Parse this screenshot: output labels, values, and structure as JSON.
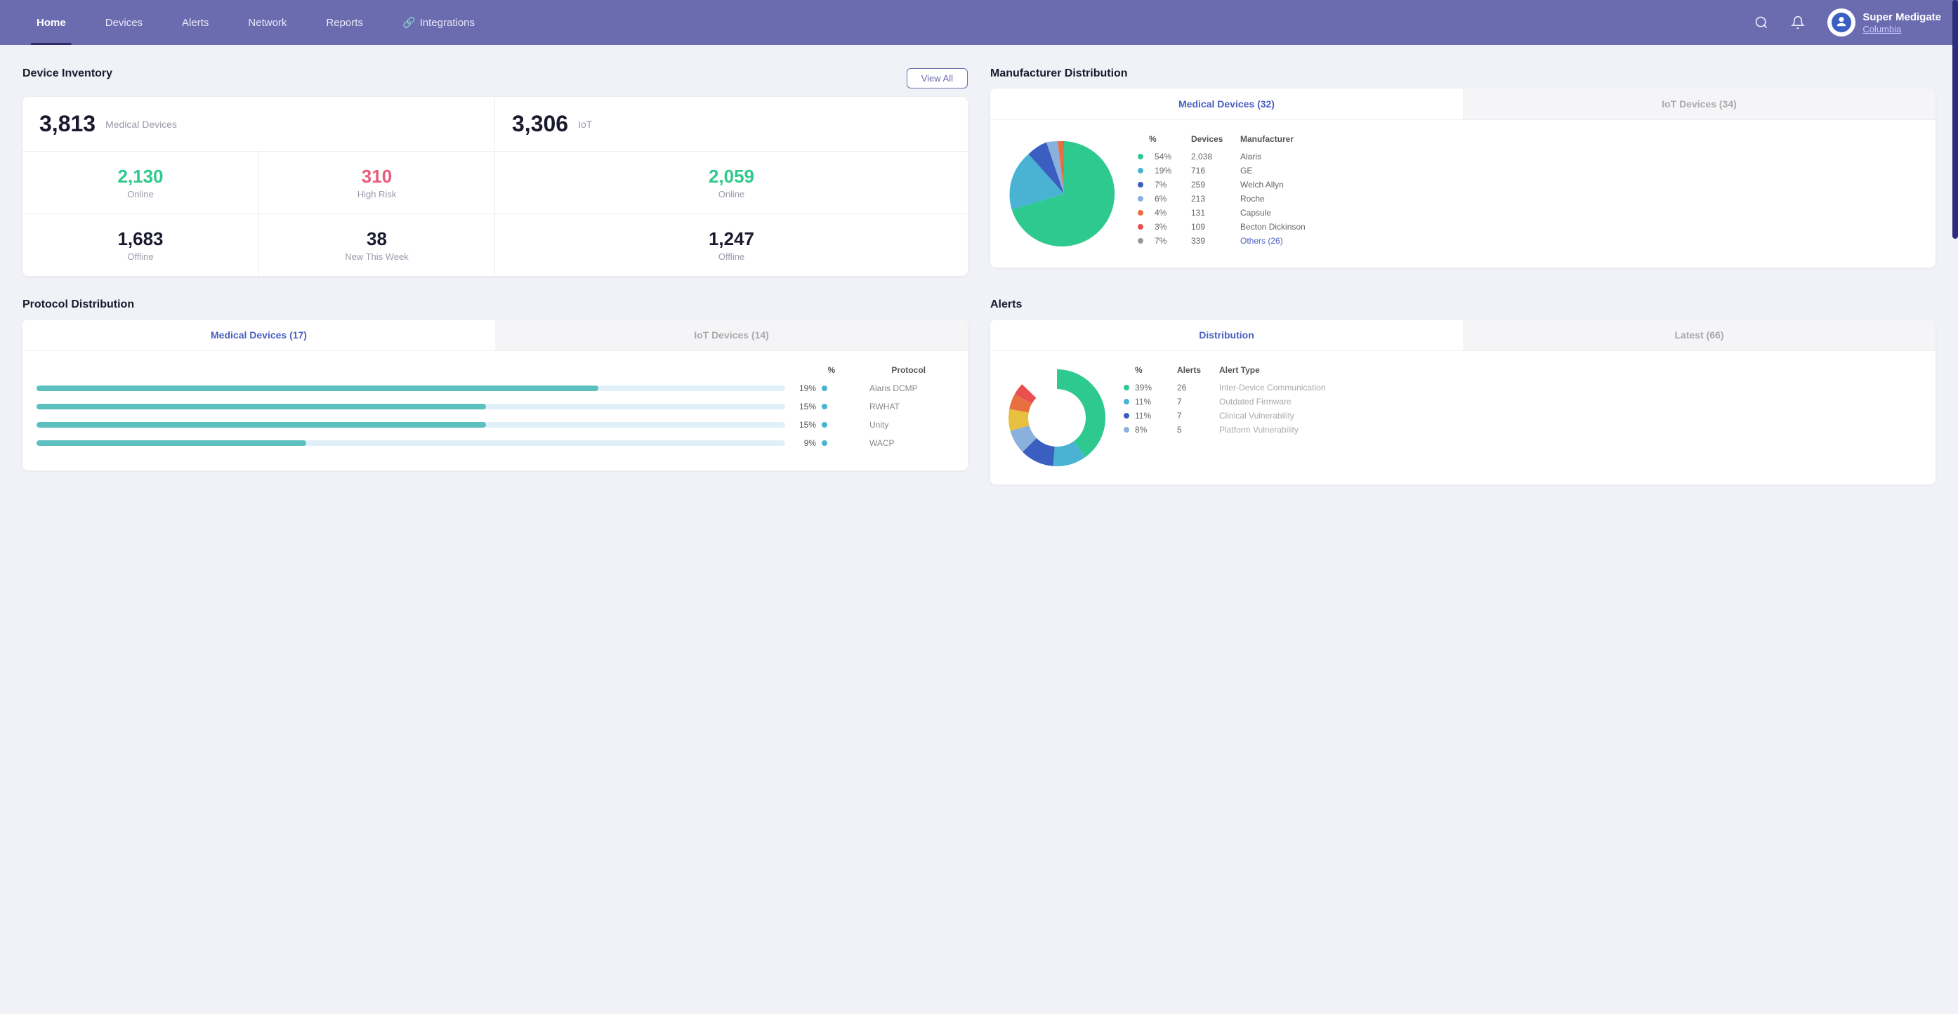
{
  "nav": {
    "items": [
      {
        "label": "Home",
        "active": true
      },
      {
        "label": "Devices",
        "active": false
      },
      {
        "label": "Alerts",
        "active": false
      },
      {
        "label": "Network",
        "active": false
      },
      {
        "label": "Reports",
        "active": false
      },
      {
        "label": "Integrations",
        "active": false
      }
    ],
    "user_name": "Super Medigate",
    "user_org": "Columbia"
  },
  "device_inventory": {
    "title": "Device Inventory",
    "view_all": "View All",
    "medical_count": "3,813",
    "medical_label": "Medical Devices",
    "iot_count": "3,306",
    "iot_label": "IoT",
    "online_count": "2,130",
    "online_label": "Online",
    "high_risk_count": "310",
    "high_risk_label": "High Risk",
    "iot_online_count": "2,059",
    "iot_online_label": "Online",
    "offline_count": "1,683",
    "offline_label": "Offline",
    "new_week_count": "38",
    "new_week_label": "New This Week",
    "iot_offline_count": "1,247",
    "iot_offline_label": "Offline"
  },
  "manufacturer": {
    "title": "Manufacturer Distribution",
    "tab_medical": "Medical Devices (32)",
    "tab_iot": "IoT Devices (34)",
    "col_pct": "%",
    "col_devices": "Devices",
    "col_manufacturer": "Manufacturer",
    "rows": [
      {
        "color": "#2ec98e",
        "pct": "54%",
        "devices": "2,038",
        "name": "Alaris"
      },
      {
        "color": "#4ab3d4",
        "pct": "19%",
        "devices": "716",
        "name": "GE"
      },
      {
        "color": "#3a5fc1",
        "pct": "7%",
        "devices": "259",
        "name": "Welch Allyn"
      },
      {
        "color": "#8ab0dc",
        "pct": "6%",
        "devices": "213",
        "name": "Roche"
      },
      {
        "color": "#e87040",
        "pct": "4%",
        "devices": "131",
        "name": "Capsule"
      },
      {
        "color": "#e85050",
        "pct": "3%",
        "devices": "109",
        "name": "Becton Dickinson"
      },
      {
        "color": "#999",
        "pct": "7%",
        "devices": "339",
        "name": "Others (26)",
        "link": true
      }
    ]
  },
  "protocol": {
    "title": "Protocol Distribution",
    "tab_medical": "Medical Devices (17)",
    "tab_iot": "IoT Devices (14)",
    "col_pct": "%",
    "col_protocol": "Protocol",
    "rows": [
      {
        "color": "#4ab3d4",
        "pct": "19%",
        "name": "Alaris DCMP",
        "bar": 75
      },
      {
        "color": "#4ab3d4",
        "pct": "15%",
        "name": "RWHAT",
        "bar": 60
      },
      {
        "color": "#4ab3d4",
        "pct": "15%",
        "name": "Unity",
        "bar": 60
      },
      {
        "color": "#4ab3d4",
        "pct": "9%",
        "name": "WACP",
        "bar": 36
      }
    ]
  },
  "alerts": {
    "title": "Alerts",
    "tab_distribution": "Distribution",
    "tab_latest": "Latest (66)",
    "col_pct": "%",
    "col_alerts": "Alerts",
    "col_type": "Alert Type",
    "rows": [
      {
        "color": "#2ec98e",
        "pct": "39%",
        "count": "26",
        "type": "Inter-Device Communication"
      },
      {
        "color": "#4ab3d4",
        "pct": "11%",
        "count": "7",
        "type": "Outdated Firmware"
      },
      {
        "color": "#3a5fc1",
        "pct": "11%",
        "count": "7",
        "type": "Clinical Vulnerability"
      },
      {
        "color": "#8ab0dc",
        "pct": "8%",
        "count": "5",
        "type": "Platform Vulnerability"
      }
    ]
  }
}
